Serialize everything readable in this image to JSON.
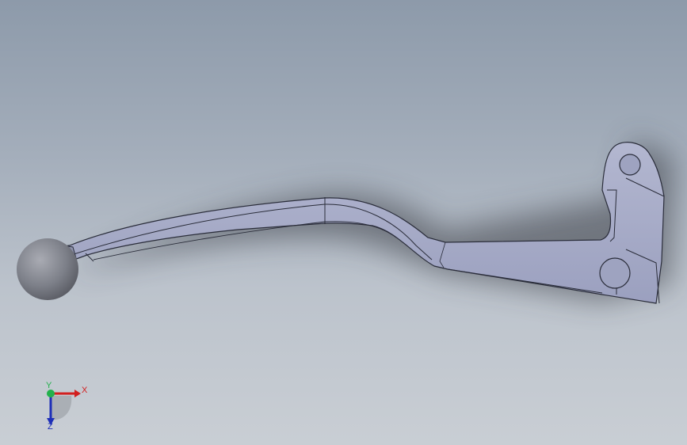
{
  "viewport": {
    "model": "brake-lever-part",
    "background_top": "#8d9aaa",
    "background_bottom": "#c9ced4",
    "part_color": "#a4a9c6",
    "edge_color": "#2a2d3a"
  },
  "triad": {
    "x_label": "X",
    "y_label": "Y",
    "z_label": "Z",
    "x_color": "#d21f1f",
    "y_color": "#22b14c",
    "z_color": "#1e2fb8"
  }
}
